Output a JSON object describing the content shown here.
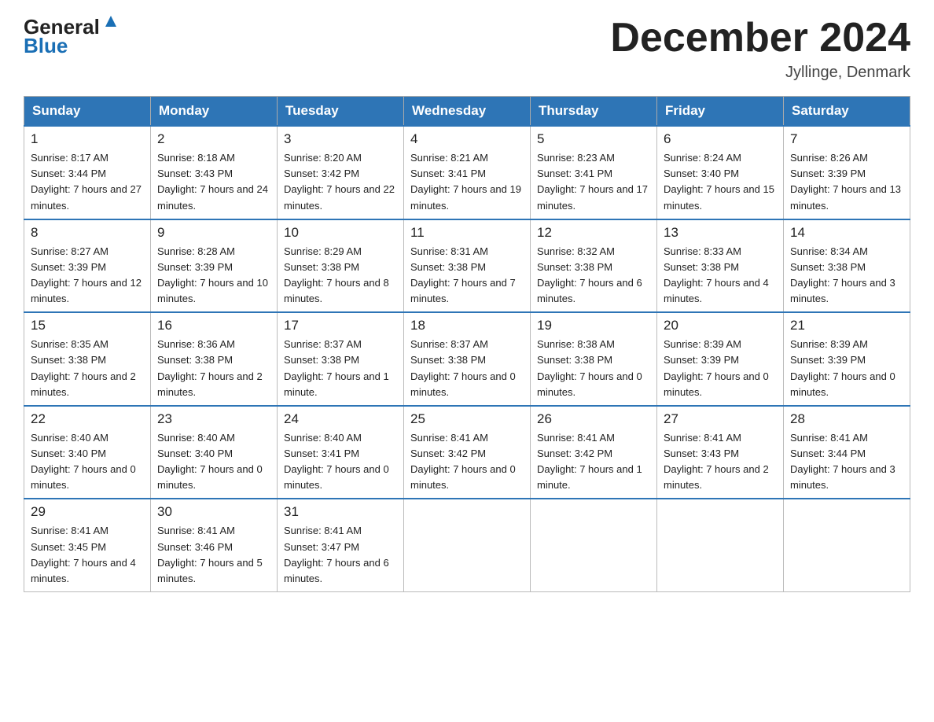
{
  "header": {
    "logo_line1": "General",
    "logo_line2": "Blue",
    "month_title": "December 2024",
    "location": "Jyllinge, Denmark"
  },
  "days_of_week": [
    "Sunday",
    "Monday",
    "Tuesday",
    "Wednesday",
    "Thursday",
    "Friday",
    "Saturday"
  ],
  "weeks": [
    [
      {
        "num": "1",
        "sunrise": "8:17 AM",
        "sunset": "3:44 PM",
        "daylight": "7 hours and 27 minutes."
      },
      {
        "num": "2",
        "sunrise": "8:18 AM",
        "sunset": "3:43 PM",
        "daylight": "7 hours and 24 minutes."
      },
      {
        "num": "3",
        "sunrise": "8:20 AM",
        "sunset": "3:42 PM",
        "daylight": "7 hours and 22 minutes."
      },
      {
        "num": "4",
        "sunrise": "8:21 AM",
        "sunset": "3:41 PM",
        "daylight": "7 hours and 19 minutes."
      },
      {
        "num": "5",
        "sunrise": "8:23 AM",
        "sunset": "3:41 PM",
        "daylight": "7 hours and 17 minutes."
      },
      {
        "num": "6",
        "sunrise": "8:24 AM",
        "sunset": "3:40 PM",
        "daylight": "7 hours and 15 minutes."
      },
      {
        "num": "7",
        "sunrise": "8:26 AM",
        "sunset": "3:39 PM",
        "daylight": "7 hours and 13 minutes."
      }
    ],
    [
      {
        "num": "8",
        "sunrise": "8:27 AM",
        "sunset": "3:39 PM",
        "daylight": "7 hours and 12 minutes."
      },
      {
        "num": "9",
        "sunrise": "8:28 AM",
        "sunset": "3:39 PM",
        "daylight": "7 hours and 10 minutes."
      },
      {
        "num": "10",
        "sunrise": "8:29 AM",
        "sunset": "3:38 PM",
        "daylight": "7 hours and 8 minutes."
      },
      {
        "num": "11",
        "sunrise": "8:31 AM",
        "sunset": "3:38 PM",
        "daylight": "7 hours and 7 minutes."
      },
      {
        "num": "12",
        "sunrise": "8:32 AM",
        "sunset": "3:38 PM",
        "daylight": "7 hours and 6 minutes."
      },
      {
        "num": "13",
        "sunrise": "8:33 AM",
        "sunset": "3:38 PM",
        "daylight": "7 hours and 4 minutes."
      },
      {
        "num": "14",
        "sunrise": "8:34 AM",
        "sunset": "3:38 PM",
        "daylight": "7 hours and 3 minutes."
      }
    ],
    [
      {
        "num": "15",
        "sunrise": "8:35 AM",
        "sunset": "3:38 PM",
        "daylight": "7 hours and 2 minutes."
      },
      {
        "num": "16",
        "sunrise": "8:36 AM",
        "sunset": "3:38 PM",
        "daylight": "7 hours and 2 minutes."
      },
      {
        "num": "17",
        "sunrise": "8:37 AM",
        "sunset": "3:38 PM",
        "daylight": "7 hours and 1 minute."
      },
      {
        "num": "18",
        "sunrise": "8:37 AM",
        "sunset": "3:38 PM",
        "daylight": "7 hours and 0 minutes."
      },
      {
        "num": "19",
        "sunrise": "8:38 AM",
        "sunset": "3:38 PM",
        "daylight": "7 hours and 0 minutes."
      },
      {
        "num": "20",
        "sunrise": "8:39 AM",
        "sunset": "3:39 PM",
        "daylight": "7 hours and 0 minutes."
      },
      {
        "num": "21",
        "sunrise": "8:39 AM",
        "sunset": "3:39 PM",
        "daylight": "7 hours and 0 minutes."
      }
    ],
    [
      {
        "num": "22",
        "sunrise": "8:40 AM",
        "sunset": "3:40 PM",
        "daylight": "7 hours and 0 minutes."
      },
      {
        "num": "23",
        "sunrise": "8:40 AM",
        "sunset": "3:40 PM",
        "daylight": "7 hours and 0 minutes."
      },
      {
        "num": "24",
        "sunrise": "8:40 AM",
        "sunset": "3:41 PM",
        "daylight": "7 hours and 0 minutes."
      },
      {
        "num": "25",
        "sunrise": "8:41 AM",
        "sunset": "3:42 PM",
        "daylight": "7 hours and 0 minutes."
      },
      {
        "num": "26",
        "sunrise": "8:41 AM",
        "sunset": "3:42 PM",
        "daylight": "7 hours and 1 minute."
      },
      {
        "num": "27",
        "sunrise": "8:41 AM",
        "sunset": "3:43 PM",
        "daylight": "7 hours and 2 minutes."
      },
      {
        "num": "28",
        "sunrise": "8:41 AM",
        "sunset": "3:44 PM",
        "daylight": "7 hours and 3 minutes."
      }
    ],
    [
      {
        "num": "29",
        "sunrise": "8:41 AM",
        "sunset": "3:45 PM",
        "daylight": "7 hours and 4 minutes."
      },
      {
        "num": "30",
        "sunrise": "8:41 AM",
        "sunset": "3:46 PM",
        "daylight": "7 hours and 5 minutes."
      },
      {
        "num": "31",
        "sunrise": "8:41 AM",
        "sunset": "3:47 PM",
        "daylight": "7 hours and 6 minutes."
      },
      null,
      null,
      null,
      null
    ]
  ]
}
